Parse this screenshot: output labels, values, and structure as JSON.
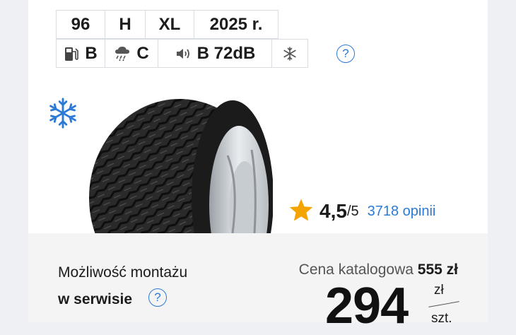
{
  "product": {
    "title_fragment": "...",
    "attributes": [
      {
        "key": "load_index",
        "value": "96"
      },
      {
        "key": "speed_index",
        "value": "H"
      },
      {
        "key": "reinforcement",
        "value": "XL"
      },
      {
        "key": "year",
        "value": "2025 r."
      }
    ],
    "eu_label": {
      "fuel_class": "B",
      "wet_grip_class": "C",
      "noise_class": "B",
      "noise_db": "72dB",
      "noise_text": "B 72dB"
    },
    "season": "winter",
    "help_glyph": "?"
  },
  "rating": {
    "value": "4,5",
    "max": "/5",
    "reviews": "3718 opinii"
  },
  "mounting": {
    "label": "Możliwość montażu",
    "service": "w serwisie",
    "help_glyph": "?"
  },
  "pricing": {
    "catalog_label": "Cena katalogowa",
    "catalog_price": "555 zł",
    "price": "294",
    "unit_currency": "zł",
    "unit_per": "szt."
  },
  "icons": {
    "fuel": "fuel-pump-icon",
    "wet": "rain-cloud-icon",
    "noise": "speaker-sound-icon",
    "snowflake": "snowflake-icon",
    "star": "star-icon"
  },
  "colors": {
    "accent": "#2b7bd6",
    "star": "#f4a300",
    "text": "#1c1c1c"
  }
}
